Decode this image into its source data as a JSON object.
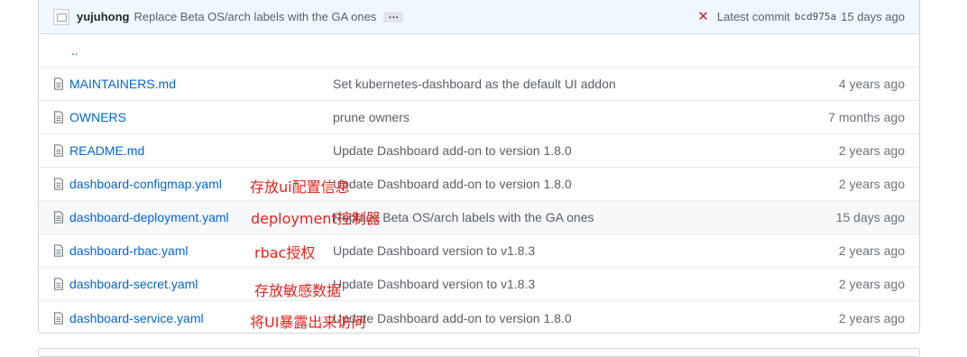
{
  "commit": {
    "author": "yujuhong",
    "message": "Replace Beta OS/arch labels with the GA ones",
    "ellipsis": "…",
    "latest_label": "Latest commit",
    "sha": "bcd975a",
    "age": "15 days ago"
  },
  "parent_link": "..",
  "files": [
    {
      "name": "MAINTAINERS.md",
      "message": "Set kubernetes-dashboard as the default UI addon",
      "age": "4 years ago"
    },
    {
      "name": "OWNERS",
      "message": "prune owners",
      "age": "7 months ago"
    },
    {
      "name": "README.md",
      "message": "Update Dashboard add-on to version 1.8.0",
      "age": "2 years ago"
    },
    {
      "name": "dashboard-configmap.yaml",
      "message": "Update Dashboard add-on to version 1.8.0",
      "age": "2 years ago"
    },
    {
      "name": "dashboard-deployment.yaml",
      "message": "Replace Beta OS/arch labels with the GA ones",
      "age": "15 days ago"
    },
    {
      "name": "dashboard-rbac.yaml",
      "message": "Update Dashboard version to v1.8.3",
      "age": "2 years ago"
    },
    {
      "name": "dashboard-secret.yaml",
      "message": "Update Dashboard version to v1.8.3",
      "age": "2 years ago"
    },
    {
      "name": "dashboard-service.yaml",
      "message": "Update Dashboard add-on to version 1.8.0",
      "age": "2 years ago"
    }
  ],
  "annotations": {
    "configmap": "存放ui配置信息",
    "deployment": "deployment控制器",
    "rbac": "rbac授权",
    "secret": "存放敏感数据",
    "service": "将UI暴露出来访问"
  },
  "colors": {
    "link": "#0366d6",
    "annotation": "#e8231b",
    "commit_bar": "#f1f8ff",
    "fail_icon": "#cb2431"
  }
}
